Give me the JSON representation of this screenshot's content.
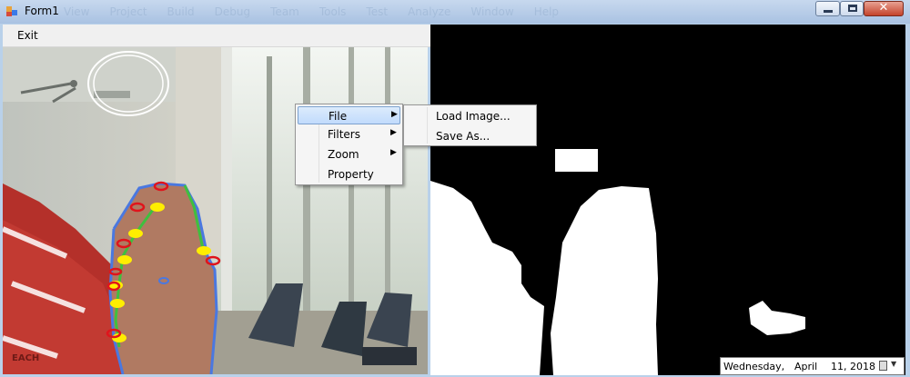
{
  "window": {
    "title": "Form1",
    "background_menu_ghost": [
      "View",
      "Project",
      "Build",
      "Debug",
      "Team",
      "Tools",
      "Test",
      "Analyze",
      "Window",
      "Help"
    ],
    "controls": {
      "minimize": "minimize-icon",
      "maximize": "maximize-icon",
      "close": "✕"
    }
  },
  "menubar": {
    "exit_label": "Exit"
  },
  "context_menu": {
    "items": [
      {
        "label": "File",
        "has_submenu": true,
        "highlighted": true
      },
      {
        "label": "Filters",
        "has_submenu": true,
        "highlighted": false
      },
      {
        "label": "Zoom",
        "has_submenu": true,
        "highlighted": false
      },
      {
        "label": "Property",
        "has_submenu": false,
        "highlighted": false
      }
    ],
    "submenu_arrow": "▶"
  },
  "file_submenu": {
    "items": [
      {
        "label": "Load Image..."
      },
      {
        "label": "Save As..."
      }
    ]
  },
  "date_picker": {
    "day_name": "Wednesday,",
    "month": "April",
    "day_year": "11, 2018",
    "icon": "calendar-icon",
    "arrow": "▼"
  },
  "panels": {
    "left": "webcam-image-with-hand-tracking",
    "right": "binary-mask-image"
  },
  "colors": {
    "marker_red": "#e0141c",
    "marker_yellow": "#ffee00",
    "contour_blue": "#4a78e0",
    "contour_green": "#3fbf3f",
    "highlight": "#c1dbfc"
  }
}
